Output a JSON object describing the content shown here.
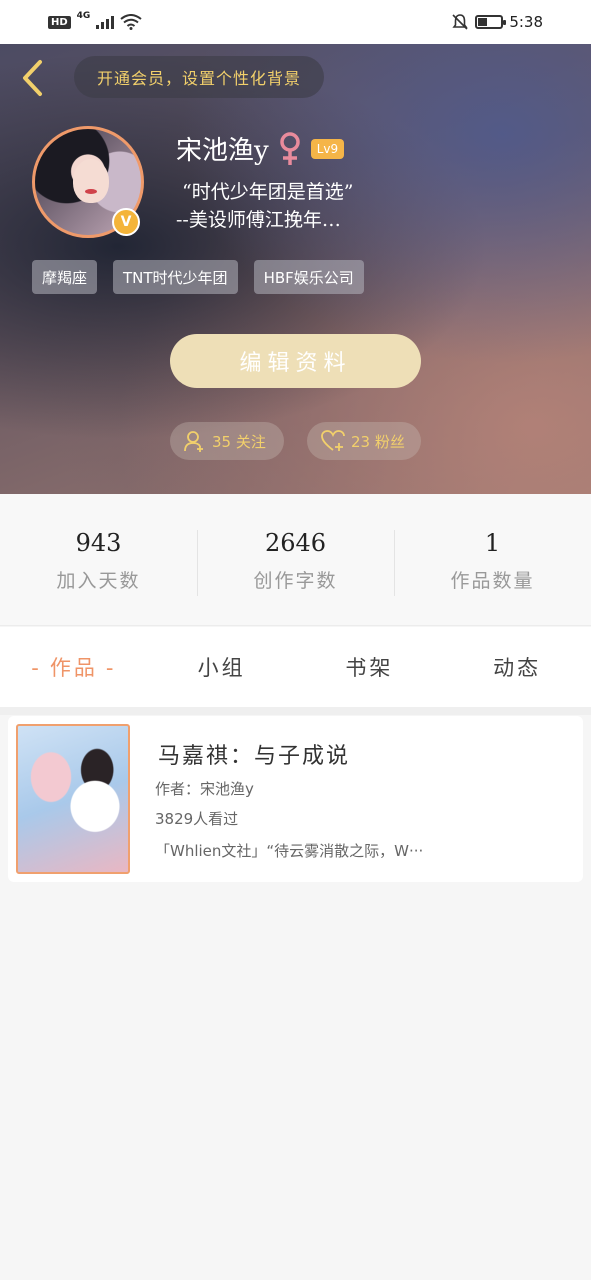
{
  "status_bar": {
    "hd": "HD",
    "network": "4G",
    "time": "5:38"
  },
  "header": {
    "vip_banner": "开通会员，设置个性化背景",
    "username": "宋池渔y",
    "gender_symbol": "♀",
    "level": "Lv9",
    "verified_badge": "V",
    "bio_line1": "“时代少年团是首选”",
    "bio_line2": "--美设师傅江挽年…",
    "tags": [
      "摩羯座",
      "TNT时代少年团",
      "HBF娱乐公司"
    ],
    "edit_button": "编辑资料",
    "follow_count_label": "35 关注",
    "fans_count_label": "23 粉丝",
    "accent_color": "#f2d06b"
  },
  "stats": [
    {
      "value": "943",
      "label": "加入天数"
    },
    {
      "value": "2646",
      "label": "创作字数"
    },
    {
      "value": "1",
      "label": "作品数量"
    }
  ],
  "tabs": [
    {
      "label": "作品",
      "dash": "-",
      "active": true
    },
    {
      "label": "小组",
      "active": false
    },
    {
      "label": "书架",
      "active": false
    },
    {
      "label": "动态",
      "active": false
    }
  ],
  "works": [
    {
      "title": "马嘉祺：与子成说",
      "author": "作者：宋池渔y",
      "views": "3829人看过",
      "excerpt": "「Whlien文社」“待云雾消散之际，W···"
    }
  ],
  "colors": {
    "tab_active": "#ef9467",
    "level_badge": "#f5b548",
    "edit_button_bg": "#eedfb7"
  }
}
